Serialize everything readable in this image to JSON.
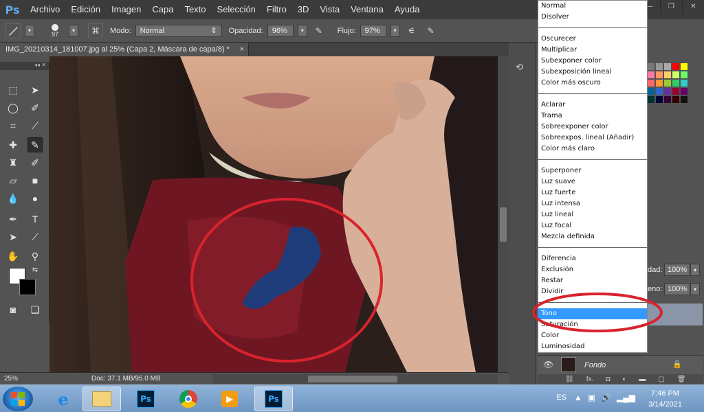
{
  "app": {
    "logo": "Ps"
  },
  "menu": [
    "Archivo",
    "Edición",
    "Imagen",
    "Capa",
    "Texto",
    "Selección",
    "Filtro",
    "3D",
    "Vista",
    "Ventana",
    "Ayuda"
  ],
  "window_buttons": {
    "min": "—",
    "max": "❐",
    "close": "✕"
  },
  "options": {
    "brush_size": "97",
    "mode_label": "Modo:",
    "mode_value": "Normal",
    "opacity_label": "Opacidad:",
    "opacity_value": "96%",
    "flow_label": "Flujo:",
    "flow_value": "97%"
  },
  "document": {
    "tab_title": "IMG_20210314_181007.jpg al 25% (Capa 2, Máscara de capa/8) *",
    "tab_close": "×"
  },
  "status": {
    "zoom": "25%",
    "doc": "Doc: 37.1 MB/95.0 MB"
  },
  "blend_modes": [
    [
      "Normal",
      "Disolver"
    ],
    [
      "Oscurecer",
      "Multiplicar",
      "Subexponer color",
      "Subexposición lineal",
      "Color más oscuro"
    ],
    [
      "Aclarar",
      "Trama",
      "Sobreexponer color",
      "Sobreexpos. lineal (Añadir)",
      "Color más claro"
    ],
    [
      "Superponer",
      "Luz suave",
      "Luz fuerte",
      "Luz intensa",
      "Luz lineal",
      "Luz focal",
      "Mezcla definida"
    ],
    [
      "Diferencia",
      "Exclusión",
      "Restar",
      "Dividir"
    ],
    [
      "Tono",
      "Saturación",
      "Color",
      "Luminosidad"
    ]
  ],
  "blend_selected": "Tono",
  "layers_panel": {
    "opacity_label": "dad:",
    "opacity_value": "100%",
    "fill_label": "eno:",
    "fill_value": "100%",
    "layer_name": "Fondo",
    "footer": [
      "⛓",
      "fx.",
      "◘",
      "◐",
      "▬",
      "▢",
      "🗑"
    ]
  },
  "taskbar": {
    "language": "ES",
    "time": "7:46 PM",
    "date": "3/14/2021",
    "apps": [
      "windows-explorer",
      "internet-explorer",
      "file-explorer",
      "photoshop",
      "chrome",
      "media-player",
      "photoshop-active"
    ]
  },
  "colors": {
    "annotation_red": "#d9232d",
    "selection_blue": "#3399ff",
    "panel_bg": "#535353",
    "taskbar": "#7aa0cc"
  }
}
